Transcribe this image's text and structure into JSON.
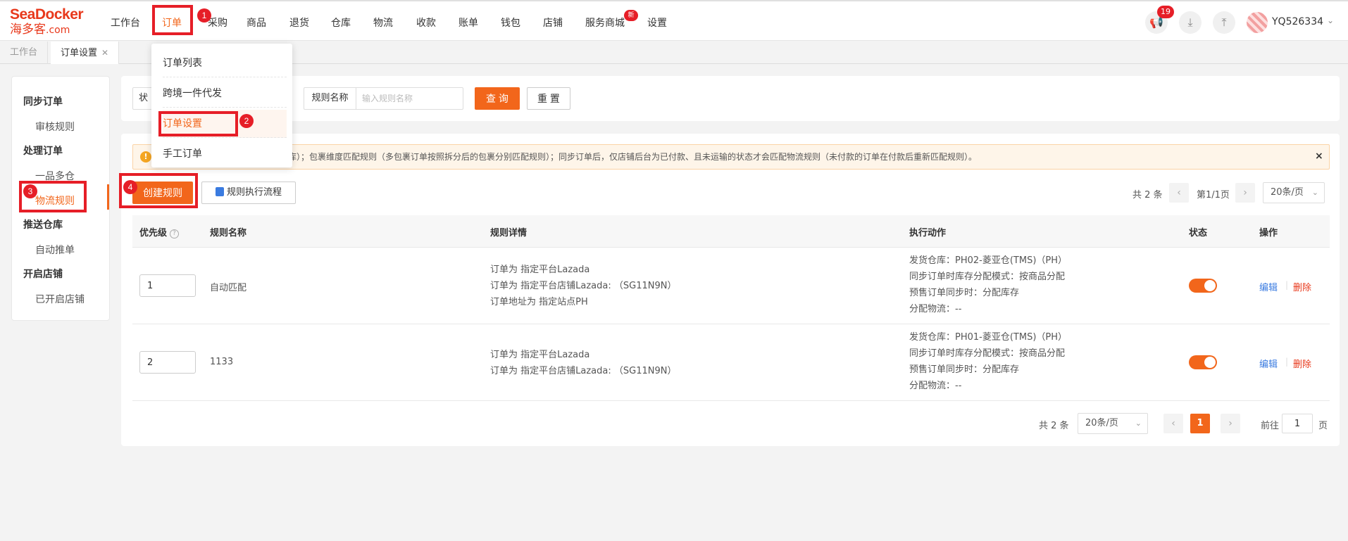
{
  "logo": {
    "top": "SeaDocker",
    "bottom": "海多客",
    "suffix": ".com"
  },
  "nav": {
    "items": [
      "工作台",
      "订单",
      "采购",
      "商品",
      "退货",
      "仓库",
      "物流",
      "收款",
      "账单",
      "钱包",
      "店铺",
      "服务商城",
      "设置"
    ],
    "service_badge": "新",
    "notif_count": "19",
    "user": "YQ526334"
  },
  "tabs": [
    "工作台",
    "订单设置"
  ],
  "sidebar": {
    "groups": [
      {
        "title": "同步订单",
        "items": [
          "审核规则"
        ]
      },
      {
        "title": "处理订单",
        "items": [
          "一品多仓",
          "物流规则"
        ]
      },
      {
        "title": "推送仓库",
        "items": [
          "自动推单"
        ]
      },
      {
        "title": "开启店铺",
        "items": [
          "已开启店铺"
        ]
      }
    ]
  },
  "dropdown": {
    "items": [
      "订单列表",
      "跨境一件代发",
      "订单设置",
      "手工订单"
    ]
  },
  "steps": [
    "1",
    "2",
    "3",
    "4"
  ],
  "filter": {
    "status_label": "状",
    "rule_name_label": "规则名称",
    "rule_name_placeholder": "输入规则名称",
    "search": "查 询",
    "reset": "重 置"
  },
  "notice": {
    "text": "仓库（平台物流订单不需要分配仓库）；包裹维度匹配规则（多包裹订单按照拆分后的包裹分别匹配规则）；同步订单后，仅店铺后台为已付款、且未运输的状态才会匹配物流规则（未付款的订单在付款后重新匹配规则）。",
    "icon": "info-icon",
    "close": "×"
  },
  "toolbar": {
    "create": "创建规则",
    "flow": "规则执行流程"
  },
  "pager_top": {
    "total": "共 2 条",
    "page": "第1/1页",
    "size": "20条/页"
  },
  "table": {
    "headers": [
      "优先级",
      "规则名称",
      "规则详情",
      "执行动作",
      "状态",
      "操作"
    ],
    "rows": [
      {
        "priority": "1",
        "name": "自动匹配",
        "details": [
          "订单为 指定平台Lazada",
          "订单为 指定平台店铺Lazada: （SG11N9N）",
          "订单地址为 指定站点PH"
        ],
        "actions": [
          "发货仓库：PH02-菱亚仓(TMS)（PH）",
          "同步订单时库存分配模式：按商品分配",
          "预售订单同步时：分配库存",
          "分配物流：--"
        ],
        "enabled": true,
        "edit": "编辑",
        "delete": "删除"
      },
      {
        "priority": "2",
        "name": "1133",
        "details": [
          "订单为 指定平台Lazada",
          "订单为 指定平台店铺Lazada: （SG11N9N）"
        ],
        "actions": [
          "发货仓库：PH01-菱亚仓(TMS)（PH）",
          "同步订单时库存分配模式：按商品分配",
          "预售订单同步时：分配库存",
          "分配物流：--"
        ],
        "enabled": true,
        "edit": "编辑",
        "delete": "删除"
      }
    ]
  },
  "pager_bottom": {
    "total": "共 2 条",
    "size": "20条/页",
    "current": "1",
    "goto_label": "前往",
    "goto_value": "1",
    "page_suffix": "页"
  },
  "colors": {
    "accent": "#f2661b",
    "annotation": "#e61e27",
    "link": "#3a7be0"
  }
}
